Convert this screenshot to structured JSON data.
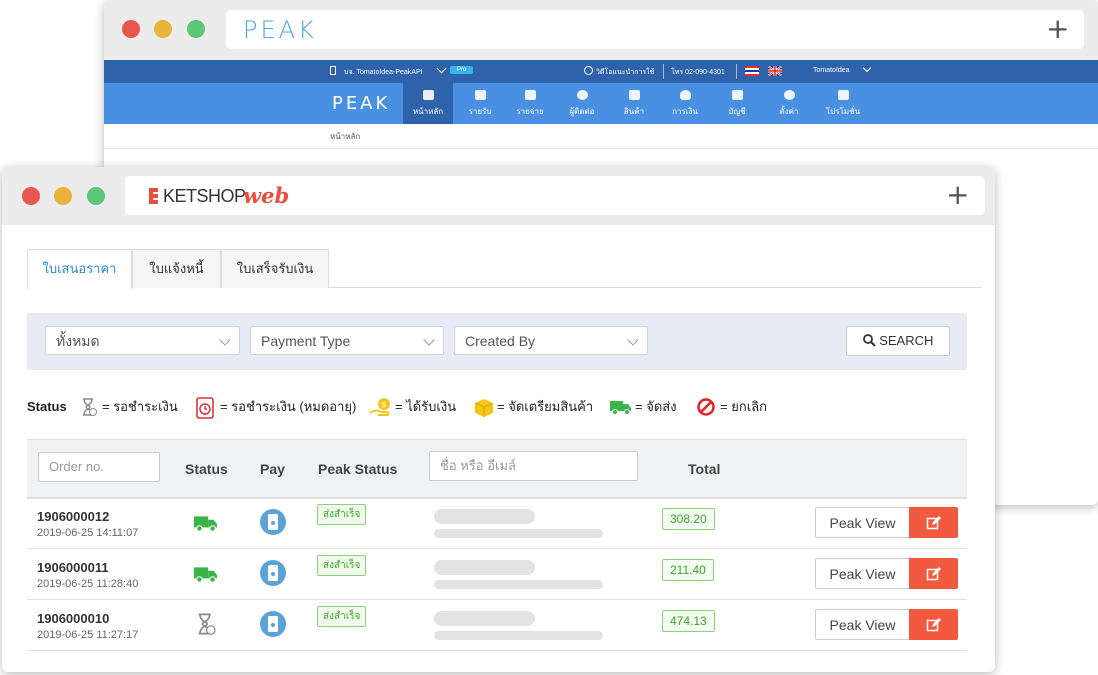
{
  "peak_window": {
    "logo": "PEAK",
    "plus": "+",
    "topbar": {
      "company": "บจ. TomatoIdea-PeakAPI",
      "plan_badge": "Pro",
      "video": "วิดีโอแนะนำการใช้",
      "phone": "โทร 02-090-4301",
      "user": "TomatoIdea"
    },
    "nav": {
      "logo": "PEAK",
      "items": [
        {
          "label": "หน้าหลัก",
          "active": true
        },
        {
          "label": "รายรับ"
        },
        {
          "label": "รายจ่าย"
        },
        {
          "label": "ผู้ติดต่อ"
        },
        {
          "label": "สินค้า"
        },
        {
          "label": "การเงิน"
        },
        {
          "label": "บัญชี"
        },
        {
          "label": "ตั้งค่า"
        },
        {
          "label": "โปรโมชั่น"
        }
      ]
    },
    "breadcrumb": "หน้าหลัก"
  },
  "ketshop_window": {
    "logo_main": "KETSHOP",
    "logo_sub": "web",
    "plus": "+",
    "tabs": [
      {
        "label": "ใบเสนอราคา",
        "active": true
      },
      {
        "label": "ใบแจ้งหนี้"
      },
      {
        "label": "ใบเสร็จรับเงิน"
      }
    ],
    "filters": {
      "status_select": "ทั้งหมด",
      "payment_type": "Payment Type",
      "created_by": "Created By",
      "search_label": "SEARCH"
    },
    "legend": {
      "title": "Status",
      "items": [
        {
          "icon": "hourglass-icon",
          "label": "= รอชำระเงิน"
        },
        {
          "icon": "expired-payment-icon",
          "label": "= รอชำระเงิน (หมดอายุ)"
        },
        {
          "icon": "money-received-icon",
          "label": "= ได้รับเงิน"
        },
        {
          "icon": "package-icon",
          "label": "= จัดเตรียมสินค้า"
        },
        {
          "icon": "delivery-truck-icon",
          "label": "= จัดส่ง"
        },
        {
          "icon": "cancel-icon",
          "label": "= ยกเลิก"
        }
      ]
    },
    "table": {
      "order_placeholder": "Order no.",
      "name_placeholder": "ชื่อ หรือ อีเมล์",
      "columns": {
        "status": "Status",
        "pay": "Pay",
        "peak_status": "Peak Status",
        "total": "Total"
      },
      "rows": [
        {
          "order": "1906000012",
          "date": "2019-06-25 14:11:07",
          "status_icon": "delivery-truck-icon",
          "peak_status": "ส่งสำเร็จ",
          "total": "308.20",
          "action": "Peak View"
        },
        {
          "order": "1906000011",
          "date": "2019-06-25 11:28:40",
          "status_icon": "delivery-truck-icon",
          "peak_status": "ส่งสำเร็จ",
          "total": "211.40",
          "action": "Peak View"
        },
        {
          "order": "1906000010",
          "date": "2019-06-25 11:27:17",
          "status_icon": "hourglass-icon",
          "peak_status": "ส่งสำเร็จ",
          "total": "474.13",
          "action": "Peak View"
        }
      ]
    }
  },
  "colors": {
    "peak_dark_blue": "#2e62ab",
    "peak_blue": "#4a90e2",
    "ketshop_red": "#f15a3f",
    "success_green": "#3ba52a",
    "tab_active_blue": "#2c8ad8"
  }
}
